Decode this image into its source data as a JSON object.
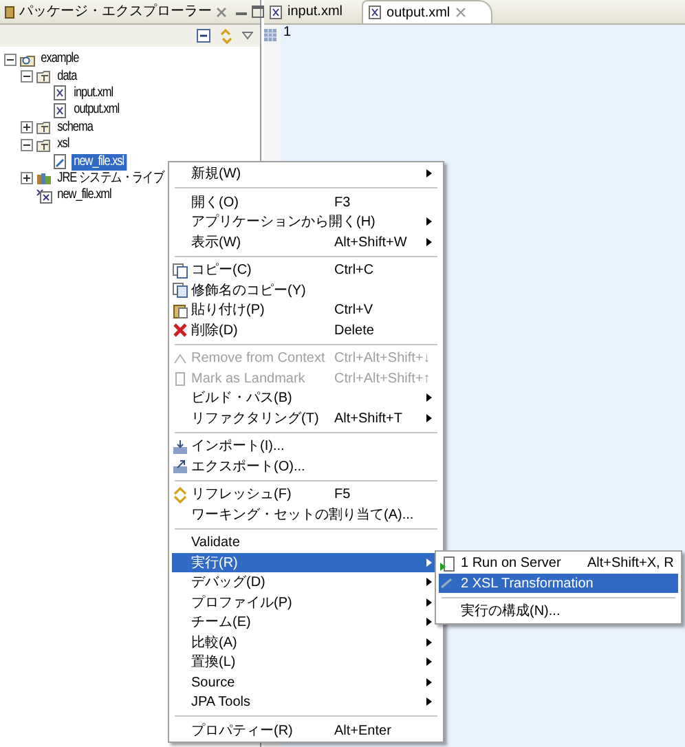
{
  "explorer": {
    "title": "パッケージ・エクスプローラー",
    "tree": [
      {
        "label": "example",
        "kind": "project",
        "expanded": true,
        "selected": false,
        "children": [
          {
            "label": "data",
            "kind": "folder",
            "expanded": true,
            "selected": false,
            "children": [
              {
                "label": "input.xml",
                "kind": "xml",
                "selected": false
              },
              {
                "label": "output.xml",
                "kind": "xml",
                "selected": false
              }
            ]
          },
          {
            "label": "schema",
            "kind": "folder",
            "expanded": false,
            "selected": false
          },
          {
            "label": "xsl",
            "kind": "folder",
            "expanded": true,
            "selected": false,
            "children": [
              {
                "label": "new_file.xsl",
                "kind": "xsl",
                "selected": true
              }
            ]
          },
          {
            "label": "JRE システム・ライブ",
            "kind": "library",
            "expanded": false,
            "selected": false
          },
          {
            "label": "new_file.xml",
            "kind": "xml-new",
            "selected": false
          }
        ]
      }
    ]
  },
  "editor": {
    "tabs": [
      {
        "label": "input.xml",
        "selected": false
      },
      {
        "label": "output.xml",
        "selected": true
      }
    ],
    "line_numbers": [
      "1"
    ]
  },
  "context_menu": {
    "groups": [
      [
        {
          "label": "新規(W)",
          "submenu": true
        }
      ],
      [
        {
          "label": "開く(O)",
          "shortcut": "F3"
        },
        {
          "label": "アプリケーションから開く(H)",
          "submenu": true
        },
        {
          "label": "表示(W)",
          "shortcut": "Alt+Shift+W",
          "submenu": true
        }
      ],
      [
        {
          "label": "コピー(C)",
          "shortcut": "Ctrl+C"
        },
        {
          "label": "修飾名のコピー(Y)"
        },
        {
          "label": "貼り付け(P)",
          "shortcut": "Ctrl+V"
        },
        {
          "label": "削除(D)",
          "shortcut": "Delete"
        }
      ],
      [
        {
          "label": "Remove from Context",
          "shortcut": "Ctrl+Alt+Shift+↓",
          "disabled": true
        },
        {
          "label": "Mark as Landmark",
          "shortcut": "Ctrl+Alt+Shift+↑",
          "disabled": true
        },
        {
          "label": "ビルド・パス(B)",
          "submenu": true
        },
        {
          "label": "リファクタリング(T)",
          "shortcut": "Alt+Shift+T",
          "submenu": true
        }
      ],
      [
        {
          "label": "インポート(I)..."
        },
        {
          "label": "エクスポート(O)..."
        }
      ],
      [
        {
          "label": "リフレッシュ(F)",
          "shortcut": "F5"
        },
        {
          "label": "ワーキング・セットの割り当て(A)..."
        }
      ],
      [
        {
          "label": "Validate"
        },
        {
          "label": "実行(R)",
          "submenu": true,
          "selected": true
        },
        {
          "label": "デバッグ(D)",
          "submenu": true
        },
        {
          "label": "プロファイル(P)",
          "submenu": true
        },
        {
          "label": "チーム(E)",
          "submenu": true
        },
        {
          "label": "比較(A)",
          "submenu": true
        },
        {
          "label": "置換(L)",
          "submenu": true
        },
        {
          "label": "Source",
          "submenu": true
        },
        {
          "label": "JPA Tools",
          "submenu": true
        }
      ],
      [
        {
          "label": "プロパティー(R)",
          "shortcut": "Alt+Enter"
        }
      ]
    ]
  },
  "submenu": {
    "groups": [
      [
        {
          "label": "1 Run on Server",
          "shortcut": "Alt+Shift+X, R",
          "selected": false
        },
        {
          "label": "2 XSL Transformation",
          "selected": true
        }
      ],
      [
        {
          "label": "実行の構成(N)...",
          "selected": false
        }
      ]
    ]
  }
}
